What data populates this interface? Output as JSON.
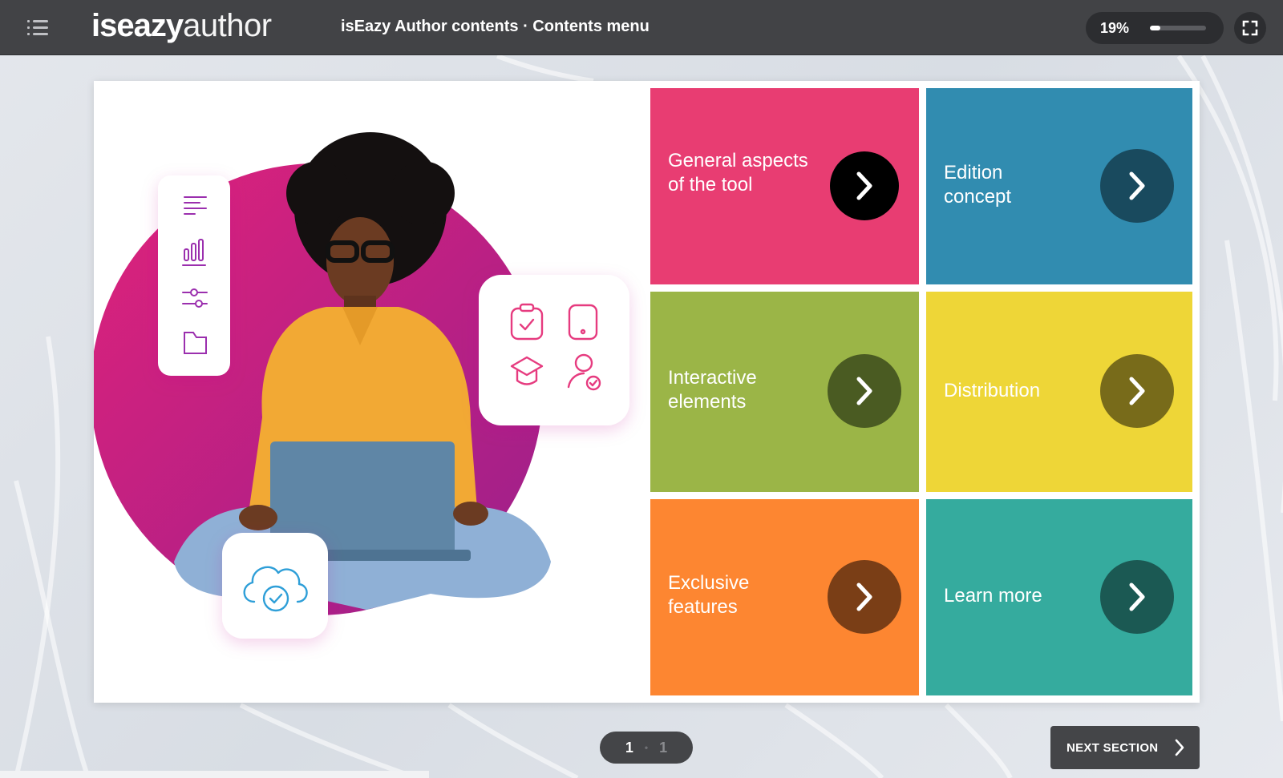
{
  "app": {
    "logo_bold": "iseazy",
    "logo_thin": "author",
    "title": "isEazy Author contents · Contents menu"
  },
  "progress": {
    "label": "19%",
    "value": 0.19
  },
  "icons": {
    "menu": "list-menu-icon",
    "fullscreen": "fullscreen-icon",
    "tile_arrow": "chevron-right-icon",
    "next": "chevron-right-icon"
  },
  "tiles": [
    {
      "label": "General aspects of the tool",
      "color": "#e83d72",
      "arrow_color": "#000000"
    },
    {
      "label": "Edition concept",
      "color": "#318cb0",
      "arrow_color": "#194a5e"
    },
    {
      "label": "Interactive elements",
      "color": "#9bb547",
      "arrow_color": "#4a5b22"
    },
    {
      "label": "Distribution",
      "color": "#eed637",
      "arrow_color": "#786b1a"
    },
    {
      "label": "Exclusive features",
      "color": "#fd8631",
      "arrow_color": "#7a3e16"
    },
    {
      "label": "Learn more",
      "color": "#35ab9e",
      "arrow_color": "#1b5953"
    }
  ],
  "pager": {
    "current": "1",
    "total": "1"
  },
  "footer": {
    "next_label": "NEXT SECTION"
  }
}
